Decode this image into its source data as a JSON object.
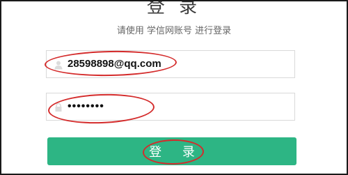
{
  "header": {
    "title": "登 录",
    "subtitle": "请使用 学信网账号 进行登录"
  },
  "form": {
    "username_value": "28598898@qq.com",
    "password_value": "••••••••",
    "username_icon": "user-icon",
    "password_icon": "lock-icon",
    "submit_label": "登 录"
  },
  "colors": {
    "button": "#2db584",
    "annotation": "#d42b2b"
  }
}
